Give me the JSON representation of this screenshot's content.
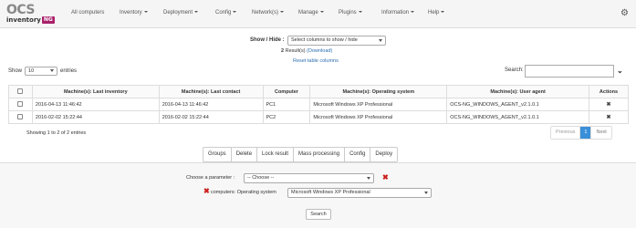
{
  "brand": {
    "logo_main": "OCS",
    "logo_sub": "inventory",
    "logo_badge": "NG"
  },
  "nav": {
    "items": [
      {
        "label": "All computers",
        "has_caret": false
      },
      {
        "label": "Inventory",
        "has_caret": true
      },
      {
        "label": "Deployment",
        "has_caret": true
      },
      {
        "label": "Config",
        "has_caret": true
      },
      {
        "label": "Network(s)",
        "has_caret": true
      },
      {
        "label": "Manage",
        "has_caret": true
      },
      {
        "label": "Plugins",
        "has_caret": true
      },
      {
        "label": "Information",
        "has_caret": true
      },
      {
        "label": "Help",
        "has_caret": true
      }
    ],
    "settings_icon": "gear-icon"
  },
  "columns_control": {
    "label": "Show / Hide :",
    "select_value": "Select columns to show / hide",
    "results_count": "2",
    "results_text": "Result(s)",
    "download_link": "(Download)",
    "reset_link": "Reset table columns"
  },
  "entries": {
    "show_label": "Show",
    "value": "10",
    "suffix": "entries"
  },
  "search": {
    "label": "Search:",
    "value": ""
  },
  "table": {
    "headers": [
      "",
      "Machine(s): Last inventory",
      "Machine(s): Last contact",
      "Computer",
      "Machine(s): Operating system",
      "Machine(s): User agent",
      "Actions"
    ],
    "rows": [
      {
        "last_inventory": "2016-04-13 11:46:42",
        "last_contact": "2016-04-13 11:46:42",
        "computer": "PC1",
        "os": "Microsoft Windows XP Professional",
        "agent": "OCS-NG_WINDOWS_AGENT_v2.1.0.1",
        "action": "✖"
      },
      {
        "last_inventory": "2016-02-02 15:22:44",
        "last_contact": "2016-02-02 15:22:44",
        "computer": "PC2",
        "os": "Microsoft Windows XP Professional",
        "agent": "OCS-NG_WINDOWS_AGENT_v2.1.0.1",
        "action": "✖"
      }
    ]
  },
  "showing_text": "Showing 1 to 2 of 2 entries",
  "pagination": {
    "previous": "Previous",
    "current": "1",
    "next": "Next"
  },
  "actions": [
    "Groups",
    "Delete",
    "Lock result",
    "Mass processing",
    "Config",
    "Deploy"
  ],
  "filter": {
    "choose_label": "Choose a parameter :",
    "choose_value": "-- Choose --",
    "criterion_label": "computers: Operating system",
    "criterion_value": "Microsoft Windows XP Professional",
    "remove_symbol": "✖",
    "search_button": "Search"
  },
  "colors": {
    "accent": "#3a8fd9",
    "remove": "#cc1e1e",
    "logo_badge": "#a8206a"
  }
}
